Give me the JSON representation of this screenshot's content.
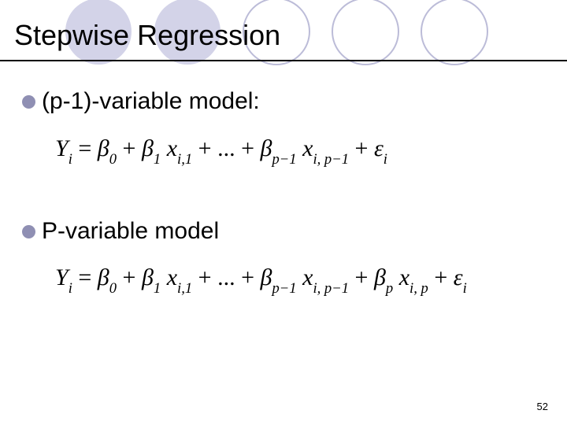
{
  "title": "Stepwise Regression",
  "bullets": {
    "b1": "(p-1)-variable model:",
    "b2": "P-variable model"
  },
  "equations": {
    "eq1": {
      "lhs_var": "Y",
      "lhs_sub": "i",
      "b0": "β",
      "b0_sub": "0",
      "b1": "β",
      "b1_sub": "1",
      "x1": "x",
      "x1_sub": "i,1",
      "mid_dots": "...",
      "bp1": "β",
      "bp1_sub": "p−1",
      "xp1": "x",
      "xp1_sub": "i, p−1",
      "eps": "ε",
      "eps_sub": "i"
    },
    "eq2": {
      "lhs_var": "Y",
      "lhs_sub": "i",
      "b0": "β",
      "b0_sub": "0",
      "b1": "β",
      "b1_sub": "1",
      "x1": "x",
      "x1_sub": "i,1",
      "mid_dots": "...",
      "bp1": "β",
      "bp1_sub": "p−1",
      "xp1": "x",
      "xp1_sub": "i, p−1",
      "bp": "β",
      "bp_sub": "p",
      "xp": "x",
      "xp_sub": "i, p",
      "eps": "ε",
      "eps_sub": "i"
    }
  },
  "page_number": "52",
  "colors": {
    "circle_fill": "#d3d3e8",
    "circle_stroke": "#bcbcd8",
    "bullet_dot": "#8f8fb3"
  }
}
